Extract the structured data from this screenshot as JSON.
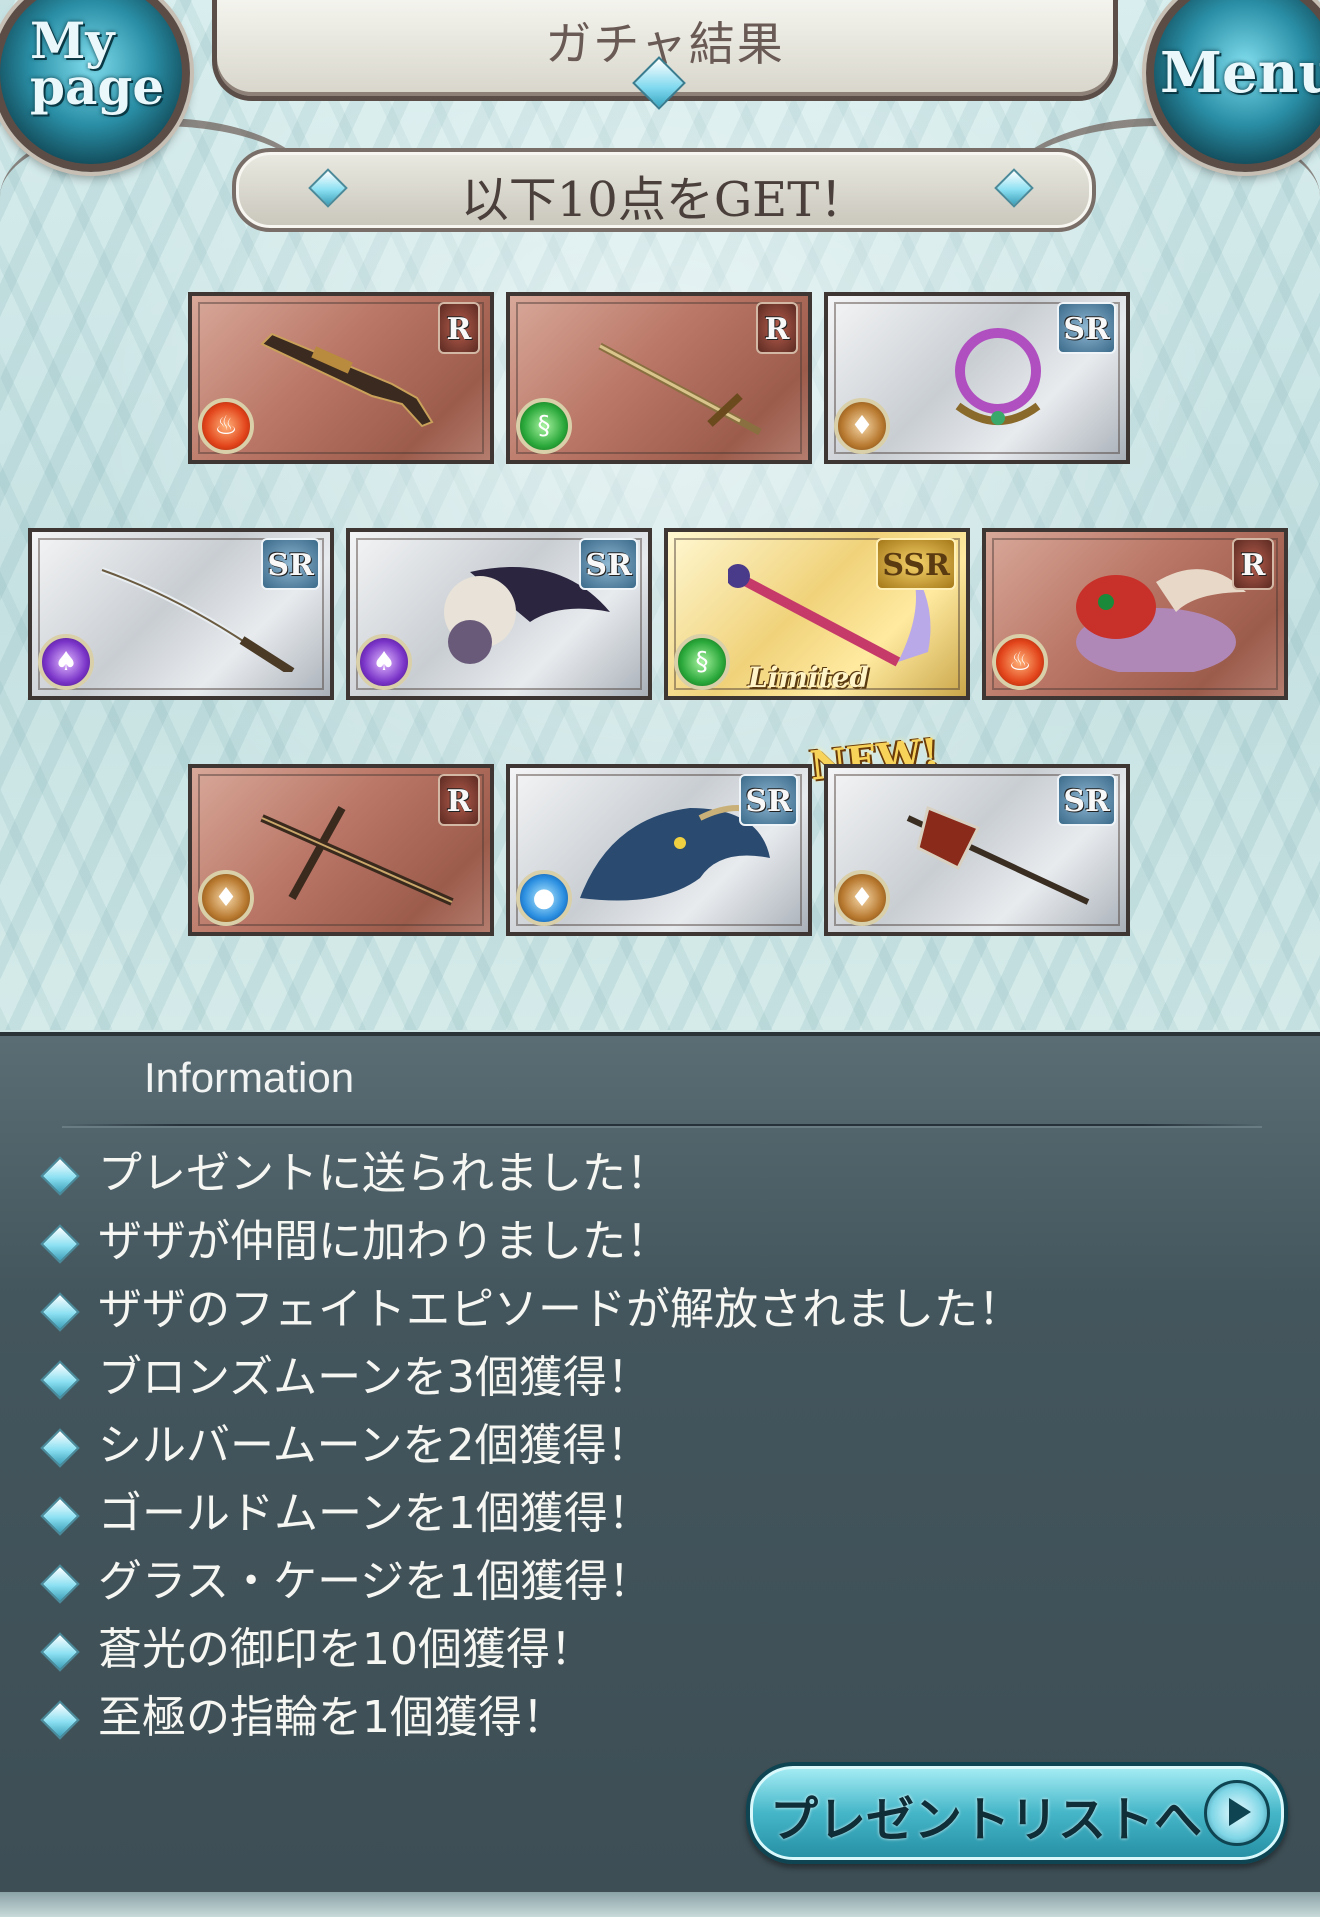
{
  "header": {
    "title": "ガチャ結果",
    "mypage_label_line1": "My",
    "mypage_label_line2": "page",
    "menu_label": "Menu"
  },
  "result_banner": "以下10点をGET！",
  "items": [
    {
      "rarity": "R",
      "element": "fire",
      "art": "gun-icon"
    },
    {
      "rarity": "R",
      "element": "wind",
      "art": "sword-icon"
    },
    {
      "rarity": "SR",
      "element": "earth",
      "art": "ring-weapon-icon"
    },
    {
      "rarity": "SR",
      "element": "dark",
      "art": "katana-icon"
    },
    {
      "rarity": "SR",
      "element": "dark",
      "art": "zaza-summon-icon"
    },
    {
      "rarity": "SSR",
      "element": "wind",
      "art": "staff-icon",
      "badge": "Limited"
    },
    {
      "rarity": "R",
      "element": "fire",
      "art": "beast-summon-icon"
    },
    {
      "rarity": "R",
      "element": "earth",
      "art": "rods-icon"
    },
    {
      "rarity": "SR",
      "element": "water",
      "art": "dragon-summon-icon"
    },
    {
      "rarity": "SR",
      "element": "earth",
      "art": "axe-spear-icon",
      "new": "NEW!"
    }
  ],
  "info": {
    "title": "Information",
    "items": [
      "プレゼントに送られました！",
      "ザザが仲間に加わりました！",
      "ザザのフェイトエピソードが解放されました！",
      "ブロンズムーンを3個獲得！",
      "シルバームーンを2個獲得！",
      "ゴールドムーンを1個獲得！",
      "グラス・ケージを1個獲得！",
      "蒼光の御印を10個獲得！",
      "至極の指輪を1個獲得！"
    ],
    "button_label": "プレゼントリストへ"
  },
  "colors": {
    "panel": "#44565d",
    "button": "#45b6c8",
    "r_card": "#b97565",
    "sr_card": "#c9ced3",
    "ssr_card": "#f0d27a"
  }
}
